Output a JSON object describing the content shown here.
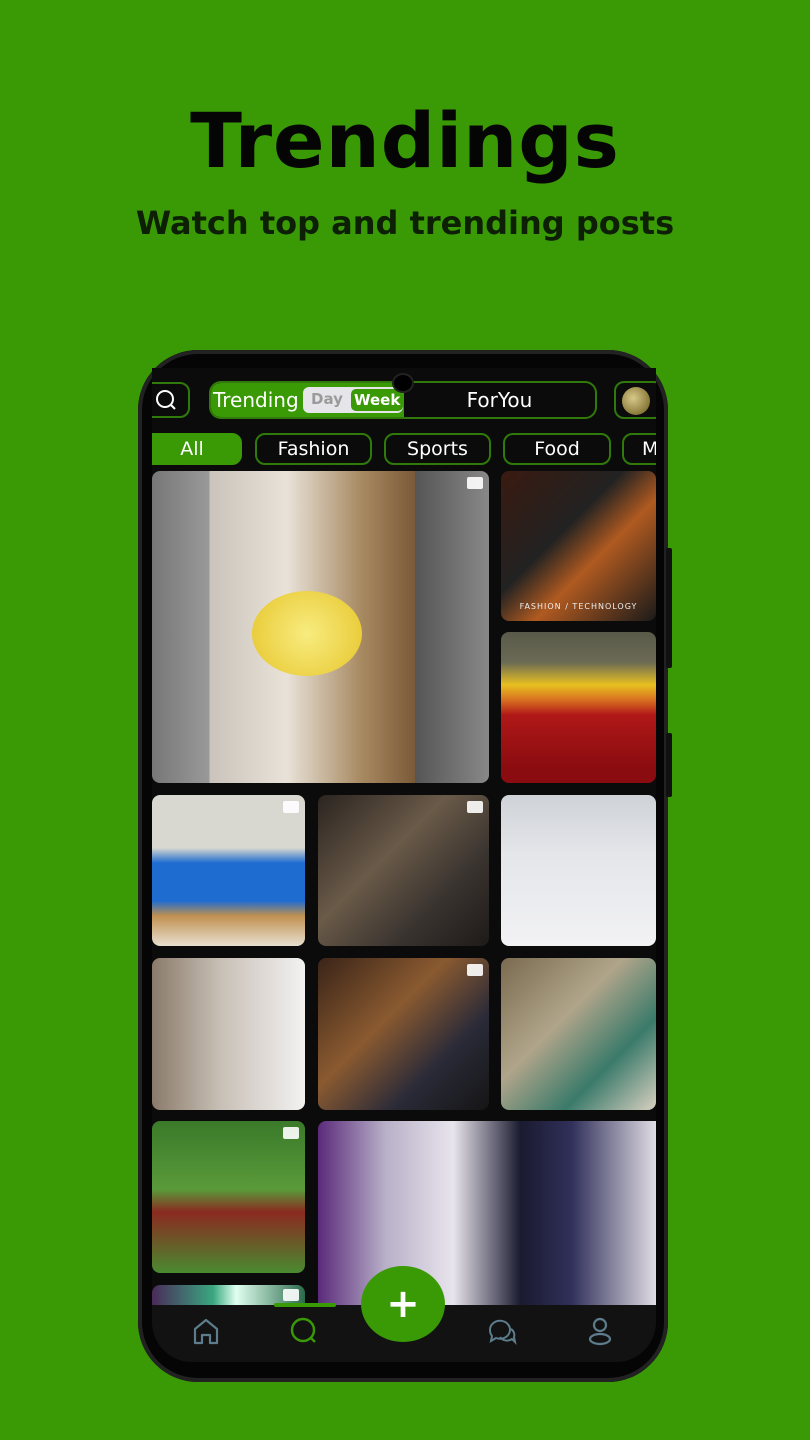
{
  "headline": {
    "title": "Trendings",
    "subtitle": "Watch top and trending posts"
  },
  "app": {
    "top_bar": {
      "search_icon": "search-icon",
      "trending_label": "Trending",
      "period_options": [
        "Day",
        "Week"
      ],
      "period_selected": "Week",
      "foryou_label": "ForYou",
      "trophy_icon": "trophy-icon"
    },
    "categories": [
      "All",
      "Fashion",
      "Sports",
      "Food",
      "M"
    ],
    "category_selected": "All",
    "feed": [
      {
        "type": "video",
        "desc": "lemon being sliced"
      },
      {
        "type": "image",
        "desc": "car seats",
        "overlay_text": "FASHION / TECHNOLOGY"
      },
      {
        "type": "image",
        "desc": "rose bouquet"
      },
      {
        "type": "video",
        "desc": "man with bread"
      },
      {
        "type": "gallery",
        "desc": "friends"
      },
      {
        "type": "image",
        "desc": "snowy street"
      },
      {
        "type": "image",
        "desc": "room"
      },
      {
        "type": "video",
        "desc": "man in studio"
      },
      {
        "type": "image",
        "desc": "woman in green"
      },
      {
        "type": "gallery",
        "desc": "football match"
      },
      {
        "type": "image",
        "desc": "performers"
      },
      {
        "type": "gallery",
        "desc": "abstract green"
      }
    ],
    "fab_label": "+",
    "nav": {
      "items": [
        "home-icon",
        "search-icon",
        "chat-icon",
        "profile-icon"
      ],
      "active": "search-icon"
    },
    "colors": {
      "brand": "#3a9a06",
      "background": "#0b0b0b",
      "nav_inactive": "#5d7c8c"
    }
  }
}
